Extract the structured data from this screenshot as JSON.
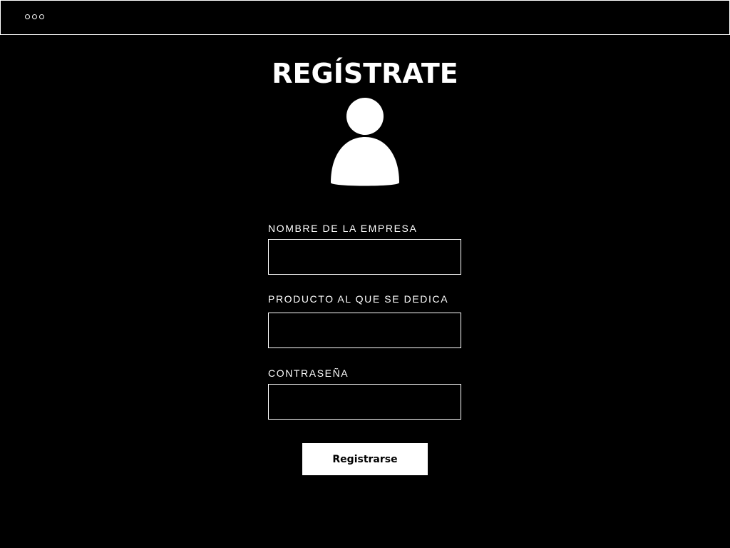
{
  "window": {
    "controls_icon": "three-dots-icon"
  },
  "form": {
    "title": "REGÍSTRATE",
    "avatar_icon": "user-avatar-icon",
    "fields": [
      {
        "label": "NOMBRE DE LA EMPRESA",
        "value": "",
        "placeholder": ""
      },
      {
        "label": "PRODUCTO AL QUE SE DEDICA",
        "value": "",
        "placeholder": ""
      },
      {
        "label": "CONTRASEÑA",
        "value": "",
        "placeholder": ""
      }
    ],
    "submit_label": "Registrarse"
  },
  "colors": {
    "background": "#000000",
    "foreground": "#ffffff"
  }
}
